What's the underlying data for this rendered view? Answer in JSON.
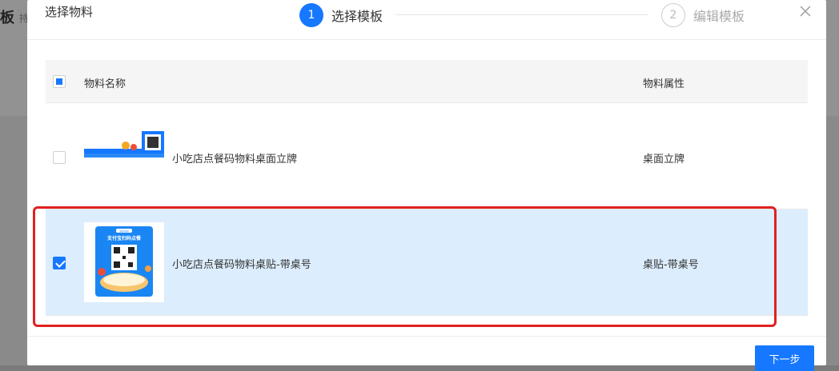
{
  "background": {
    "title": "板",
    "subtitle": "持"
  },
  "modal": {
    "title": "选择物料",
    "steps": [
      {
        "number": "1",
        "label": "选择模板",
        "state": "active"
      },
      {
        "number": "2",
        "label": "编辑模板",
        "state": "inactive"
      }
    ],
    "close_icon": "close-icon"
  },
  "table": {
    "columns": [
      "物料名称",
      "物料属性"
    ],
    "header_checkbox_state": "indeterminate",
    "rows": [
      {
        "name": "小吃店点餐码物料桌面立牌",
        "attribute": "桌面立牌",
        "checked": false
      },
      {
        "name": "小吃店点餐码物料桌贴-带桌号",
        "attribute": "桌贴-带桌号",
        "checked": true
      }
    ]
  },
  "thumbnails": {
    "row2_banner": "支付宝扫码点餐",
    "row2_tag": "SWGW"
  },
  "footer": {
    "next_label": "下一步"
  },
  "colors": {
    "primary": "#1677ff",
    "selected_row": "#dcedfd",
    "highlight": "#e02020"
  }
}
